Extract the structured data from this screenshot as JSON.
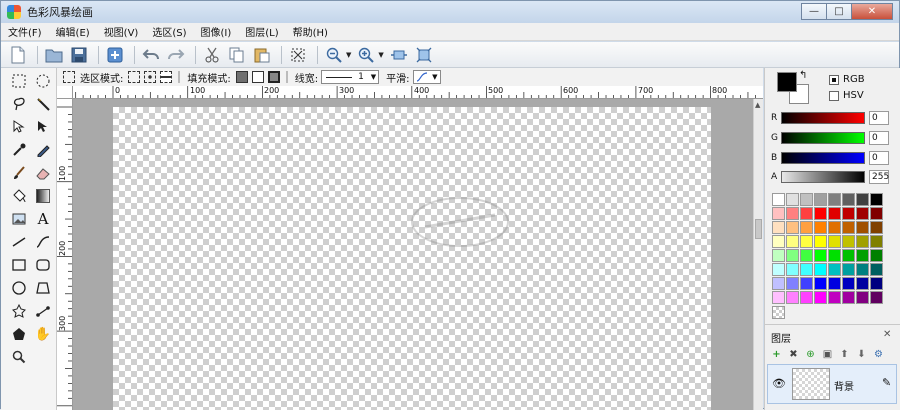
{
  "window": {
    "title": "色彩风暴绘画",
    "min": "—",
    "max": "□",
    "close": "✕"
  },
  "menu": [
    "文件(F)",
    "编辑(E)",
    "视图(V)",
    "选区(S)",
    "图像(I)",
    "图层(L)",
    "帮助(H)"
  ],
  "toolbar_icons": [
    "new-file-icon",
    "open-folder-icon",
    "save-icon",
    "add-icon",
    "undo-icon",
    "redo-icon",
    "cut-icon",
    "copy-icon",
    "paste-icon",
    "deselect-icon",
    "zoom-out-icon",
    "zoom-in-icon",
    "fit-width-icon",
    "fit-window-icon"
  ],
  "options": {
    "select_mode_label": "选区模式:",
    "fill_mode_label": "填充模式:",
    "line_width_label": "线宽:",
    "line_width_value": "1",
    "smooth_label": "平滑:"
  },
  "ruler": {
    "h_labels": [
      "0",
      "100",
      "200",
      "300",
      "400",
      "500",
      "600",
      "700",
      "800"
    ],
    "v_labels": [
      "100",
      "200",
      "300"
    ]
  },
  "color": {
    "rgb_label": "RGB",
    "hsv_label": "HSV",
    "r_label": "R",
    "r_value": "0",
    "g_label": "G",
    "g_value": "0",
    "b_label": "B",
    "b_value": "0",
    "a_label": "A",
    "a_value": "255",
    "palette": [
      "#ffffff",
      "#e0e0e0",
      "#c0c0c0",
      "#a0a0a0",
      "#808080",
      "#606060",
      "#404040",
      "#000000",
      "#ffc0c0",
      "#ff8080",
      "#ff4040",
      "#ff0000",
      "#e00000",
      "#c00000",
      "#a00000",
      "#800000",
      "#ffe0c0",
      "#ffc080",
      "#ffa040",
      "#ff8000",
      "#e07000",
      "#c06000",
      "#a05000",
      "#804000",
      "#ffffc0",
      "#ffff80",
      "#ffff40",
      "#ffff00",
      "#e0e000",
      "#c0c000",
      "#a0a000",
      "#808000",
      "#c0ffc0",
      "#80ff80",
      "#40ff40",
      "#00ff00",
      "#00e000",
      "#00c000",
      "#00a000",
      "#008000",
      "#c0ffff",
      "#80ffff",
      "#40ffff",
      "#00ffff",
      "#00c0c0",
      "#00a0a0",
      "#008080",
      "#006060",
      "#c0c0ff",
      "#8080ff",
      "#4040ff",
      "#0000ff",
      "#0000e0",
      "#0000c0",
      "#0000a0",
      "#000080",
      "#ffc0ff",
      "#ff80ff",
      "#ff40ff",
      "#ff00ff",
      "#c000c0",
      "#a000a0",
      "#800080",
      "#600060"
    ]
  },
  "layers": {
    "title": "图层",
    "close": "✕",
    "layer_name": "背景"
  }
}
